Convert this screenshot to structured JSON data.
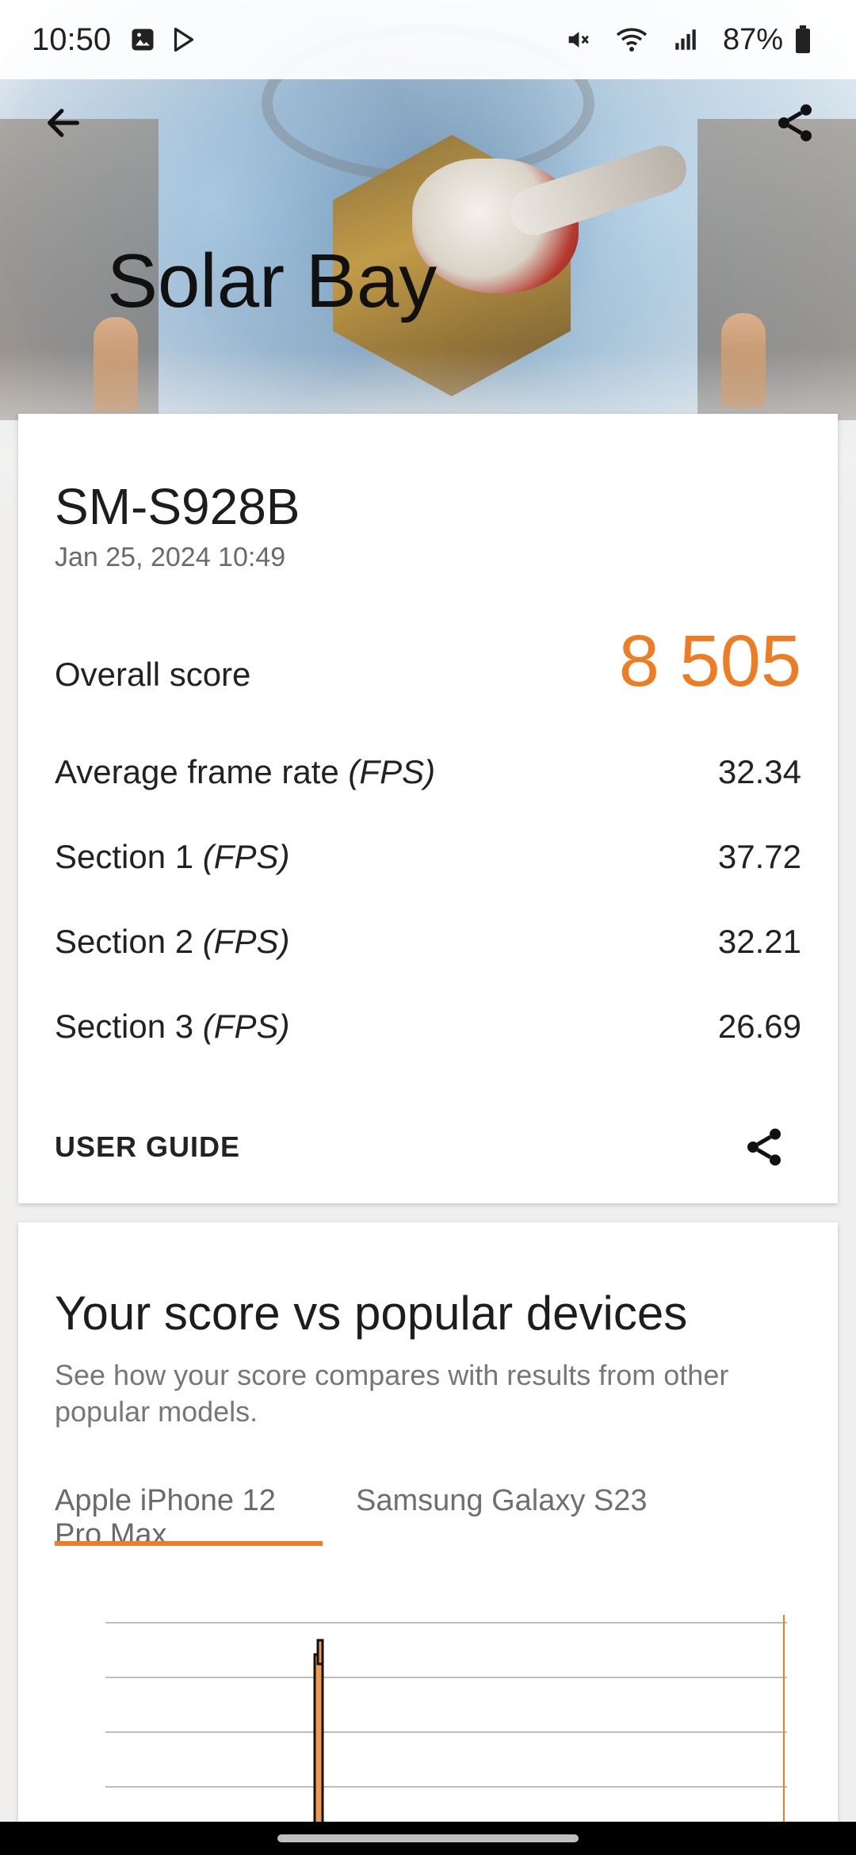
{
  "status_bar": {
    "time": "10:50",
    "battery": "87%",
    "left_icons": [
      "gallery-icon",
      "play-store-icon"
    ],
    "right_icons": [
      "mute-icon",
      "wifi-icon",
      "signal-icon",
      "battery-icon"
    ]
  },
  "header": {
    "title": "Solar Bay",
    "back_icon": "arrow-left-icon",
    "share_icon": "share-icon"
  },
  "result": {
    "device_name": "SM-S928B",
    "date": "Jan 25, 2024 10:49",
    "overall_label": "Overall score",
    "overall_value": "8 505",
    "avg_label": "Average frame rate",
    "avg_unit": "(FPS)",
    "avg_value": "32.34",
    "section1_label": "Section 1",
    "section1_unit": "(FPS)",
    "section1_value": "37.72",
    "section2_label": "Section 2",
    "section2_unit": "(FPS)",
    "section2_value": "32.21",
    "section3_label": "Section 3",
    "section3_unit": "(FPS)",
    "section3_value": "26.69",
    "user_guide": "USER GUIDE"
  },
  "compare": {
    "title": "Your score vs popular devices",
    "subtitle": "See how your score compares with results from other popular models.",
    "tabs": [
      "Apple iPhone 12 Pro Max",
      "Samsung Galaxy S23"
    ],
    "active_tab": 0
  },
  "colors": {
    "accent": "#ef7b22",
    "text": "#222222",
    "muted": "#777777"
  }
}
